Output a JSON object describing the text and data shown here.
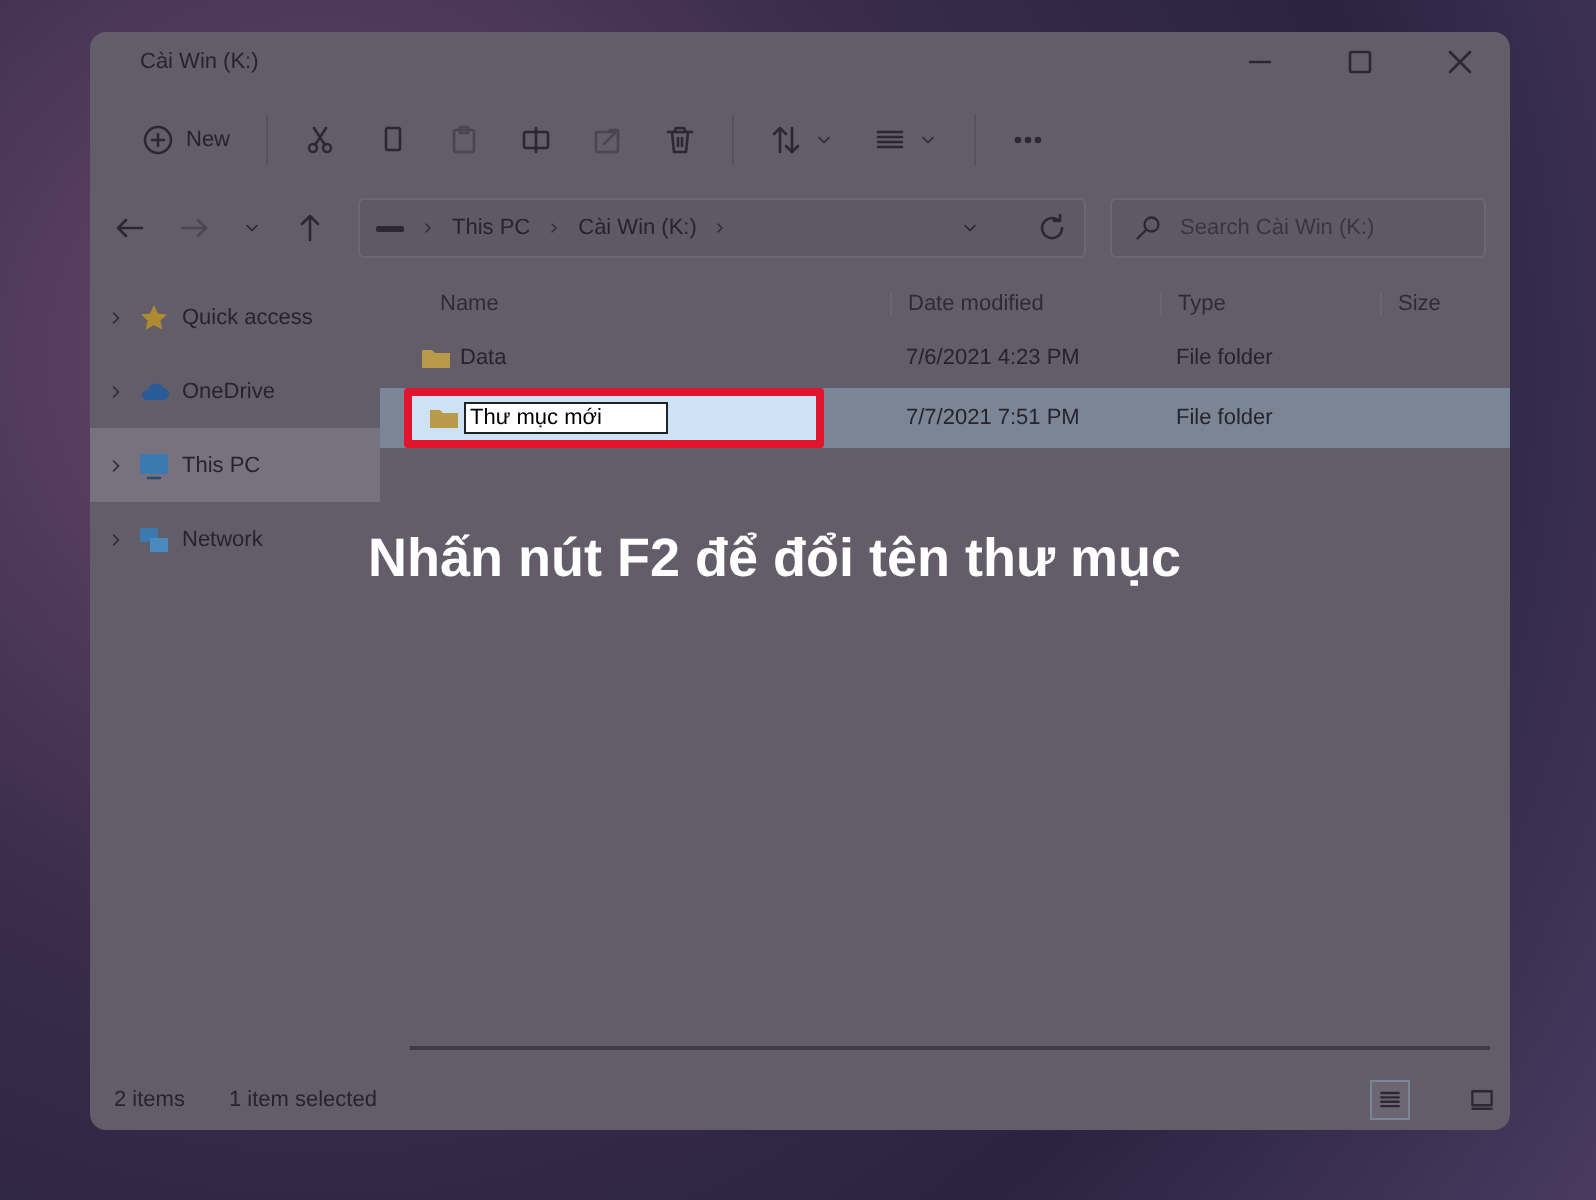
{
  "window": {
    "title": "Cài Win (K:)"
  },
  "toolbar": {
    "new_label": "New"
  },
  "address": {
    "crumbs": [
      "This PC",
      "Cài Win (K:)"
    ]
  },
  "search": {
    "placeholder": "Search Cài Win (K:)"
  },
  "sidebar": {
    "items": [
      {
        "label": "Quick access",
        "kind": "star",
        "selected": false
      },
      {
        "label": "OneDrive",
        "kind": "cloud",
        "selected": false
      },
      {
        "label": "This PC",
        "kind": "monitor",
        "selected": true
      },
      {
        "label": "Network",
        "kind": "network",
        "selected": false
      }
    ]
  },
  "table": {
    "columns": [
      "Name",
      "Date modified",
      "Type",
      "Size"
    ],
    "rows": [
      {
        "name": "Data",
        "date": "7/6/2021 4:23 PM",
        "type": "File folder",
        "selected": false,
        "editing": false
      },
      {
        "name": "Thư mục mới",
        "date": "7/7/2021 7:51 PM",
        "type": "File folder",
        "selected": true,
        "editing": true
      }
    ]
  },
  "caption": "Nhấn nút F2 để đổi tên thư mục",
  "status_bar": {
    "item_count": "2 items",
    "selection": "1 item selected"
  },
  "view_buttons": [
    {
      "kind": "details",
      "selected": true
    },
    {
      "kind": "tiles",
      "selected": false
    }
  ]
}
